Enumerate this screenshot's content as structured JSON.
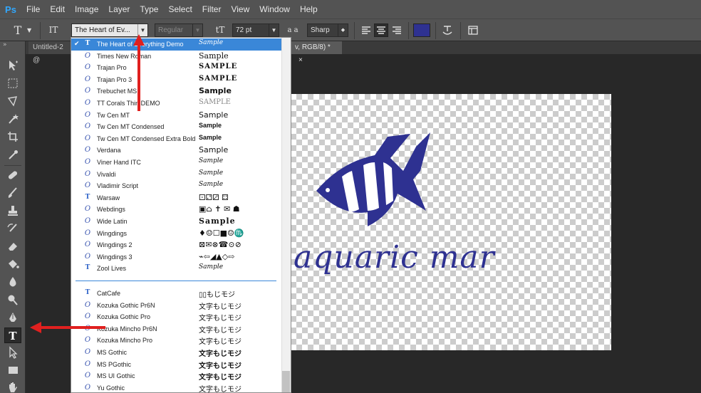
{
  "app": {
    "logo": "Ps",
    "accent": "#31a8ff"
  },
  "menu": [
    "File",
    "Edit",
    "Image",
    "Layer",
    "Type",
    "Select",
    "Filter",
    "View",
    "Window",
    "Help"
  ],
  "options": {
    "tool_icon": "T",
    "orient_icon": "IT",
    "font_family": "The Heart of Ev...",
    "font_style": "Regular",
    "size_icon": "tT",
    "font_size": "72 pt",
    "aa_icon": "a a",
    "antialias": "Sharp",
    "text_color": "#2e3191",
    "warp_icon": "warp-text-icon",
    "panel_icon": "character-panel-icon"
  },
  "tabs": {
    "left": "Untitled-2 @",
    "right": "v, RGB/8) *",
    "close": "×"
  },
  "toolbar": {
    "collapse": "»",
    "tools": [
      "move",
      "marquee",
      "lasso",
      "quick-select",
      "crop",
      "eyedropper",
      "healing",
      "brush",
      "stamp",
      "history-brush",
      "eraser",
      "paint-bucket",
      "blur",
      "dodge",
      "pen",
      "type",
      "path-select",
      "rectangle",
      "hand"
    ],
    "type_label": "T"
  },
  "canvas": {
    "text": "aquaric mar",
    "logo_color": "#2e3191"
  },
  "font_list": [
    {
      "name": "The Heart of Everything Demo",
      "sample": "Sample",
      "icon": "T",
      "selected": true
    },
    {
      "name": "Times New Roman",
      "sample": "Sample",
      "icon": "O"
    },
    {
      "name": "Trajan Pro",
      "sample": "SAMPLE",
      "icon": "O"
    },
    {
      "name": "Trajan Pro 3",
      "sample": "SAMPLE",
      "icon": "O"
    },
    {
      "name": "Trebuchet MS",
      "sample": "Sample",
      "icon": "O"
    },
    {
      "name": "TT Corals Thin DEMO",
      "sample": "SAMPLE",
      "icon": "O"
    },
    {
      "name": "Tw Cen MT",
      "sample": "Sample",
      "icon": "O"
    },
    {
      "name": "Tw Cen MT Condensed",
      "sample": "Sample",
      "icon": "O"
    },
    {
      "name": "Tw Cen MT Condensed Extra Bold",
      "sample": "Sample",
      "icon": "O"
    },
    {
      "name": "Verdana",
      "sample": "Sample",
      "icon": "O"
    },
    {
      "name": "Viner Hand ITC",
      "sample": "Sample",
      "icon": "O"
    },
    {
      "name": "Vivaldi",
      "sample": "Sample",
      "icon": "O"
    },
    {
      "name": "Vladimir Script",
      "sample": "Sample",
      "icon": "O"
    },
    {
      "name": "Warsaw",
      "sample": "⚀⚁⚂ ⚃",
      "icon": "T"
    },
    {
      "name": "Webdings",
      "sample": "▣⌂ ✝ ✉ ☗",
      "icon": "O"
    },
    {
      "name": "Wide Latin",
      "sample": "Sample",
      "icon": "O"
    },
    {
      "name": "Wingdings",
      "sample": "♦☺☐■☺♏",
      "icon": "O"
    },
    {
      "name": "Wingdings 2",
      "sample": "⊠✉⊗☎⊙⊘",
      "icon": "O"
    },
    {
      "name": "Wingdings 3",
      "sample": "⌁⇦◢▲◇⇨",
      "icon": "O"
    },
    {
      "name": "Zool Lives",
      "sample": "Sample",
      "icon": "T"
    },
    {
      "name": "CatCafe",
      "sample": "▯▯もじモジ",
      "icon": "T"
    },
    {
      "name": "Kozuka Gothic Pr6N",
      "sample": "文字もじモジ",
      "icon": "O"
    },
    {
      "name": "Kozuka Gothic Pro",
      "sample": "文字もじモジ",
      "icon": "O"
    },
    {
      "name": "Kozuka Mincho Pr6N",
      "sample": "文字もじモジ",
      "icon": "O"
    },
    {
      "name": "Kozuka Mincho Pro",
      "sample": "文字もじモジ",
      "icon": "O"
    },
    {
      "name": "MS Gothic",
      "sample": "文字もじモジ",
      "icon": "O"
    },
    {
      "name": "MS PGothic",
      "sample": "文字もじモジ",
      "icon": "O"
    },
    {
      "name": "MS UI Gothic",
      "sample": "文字もじモジ",
      "icon": "O"
    },
    {
      "name": "Yu Gothic",
      "sample": "文字もじモジ",
      "icon": "O"
    }
  ],
  "annotation_color": "#e0201f"
}
